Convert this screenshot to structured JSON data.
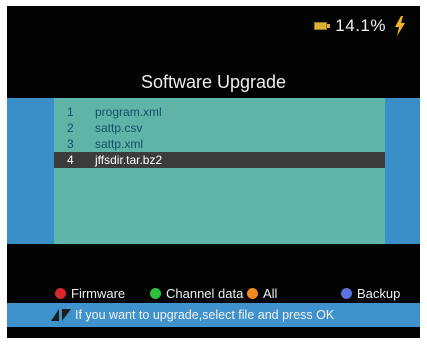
{
  "status": {
    "battery_percent": "14.1%",
    "battery_icon": "battery-icon",
    "charge_icon": "lightning-bolt-icon"
  },
  "title": "Software Upgrade",
  "files": [
    {
      "num": "1",
      "name": "program.xml",
      "selected": false
    },
    {
      "num": "2",
      "name": "sattp.csv",
      "selected": false
    },
    {
      "num": "3",
      "name": "sattp.xml",
      "selected": false
    },
    {
      "num": "4",
      "name": "jffsdir.tar.bz2",
      "selected": true
    }
  ],
  "legend": [
    {
      "label": "Firmware",
      "color": "#d8262a"
    },
    {
      "label": "Channel data",
      "color": "#2cc13a"
    },
    {
      "label": "All",
      "color": "#f08a20"
    },
    {
      "label": "Backup",
      "color": "#5a73e0"
    }
  ],
  "hint": "If you want to upgrade,select file and press OK",
  "colors": {
    "background": "#030303",
    "panel_blue": "#3b8fc8",
    "list_teal": "#5fb4a8",
    "selected_row": "#3c3c3c"
  }
}
